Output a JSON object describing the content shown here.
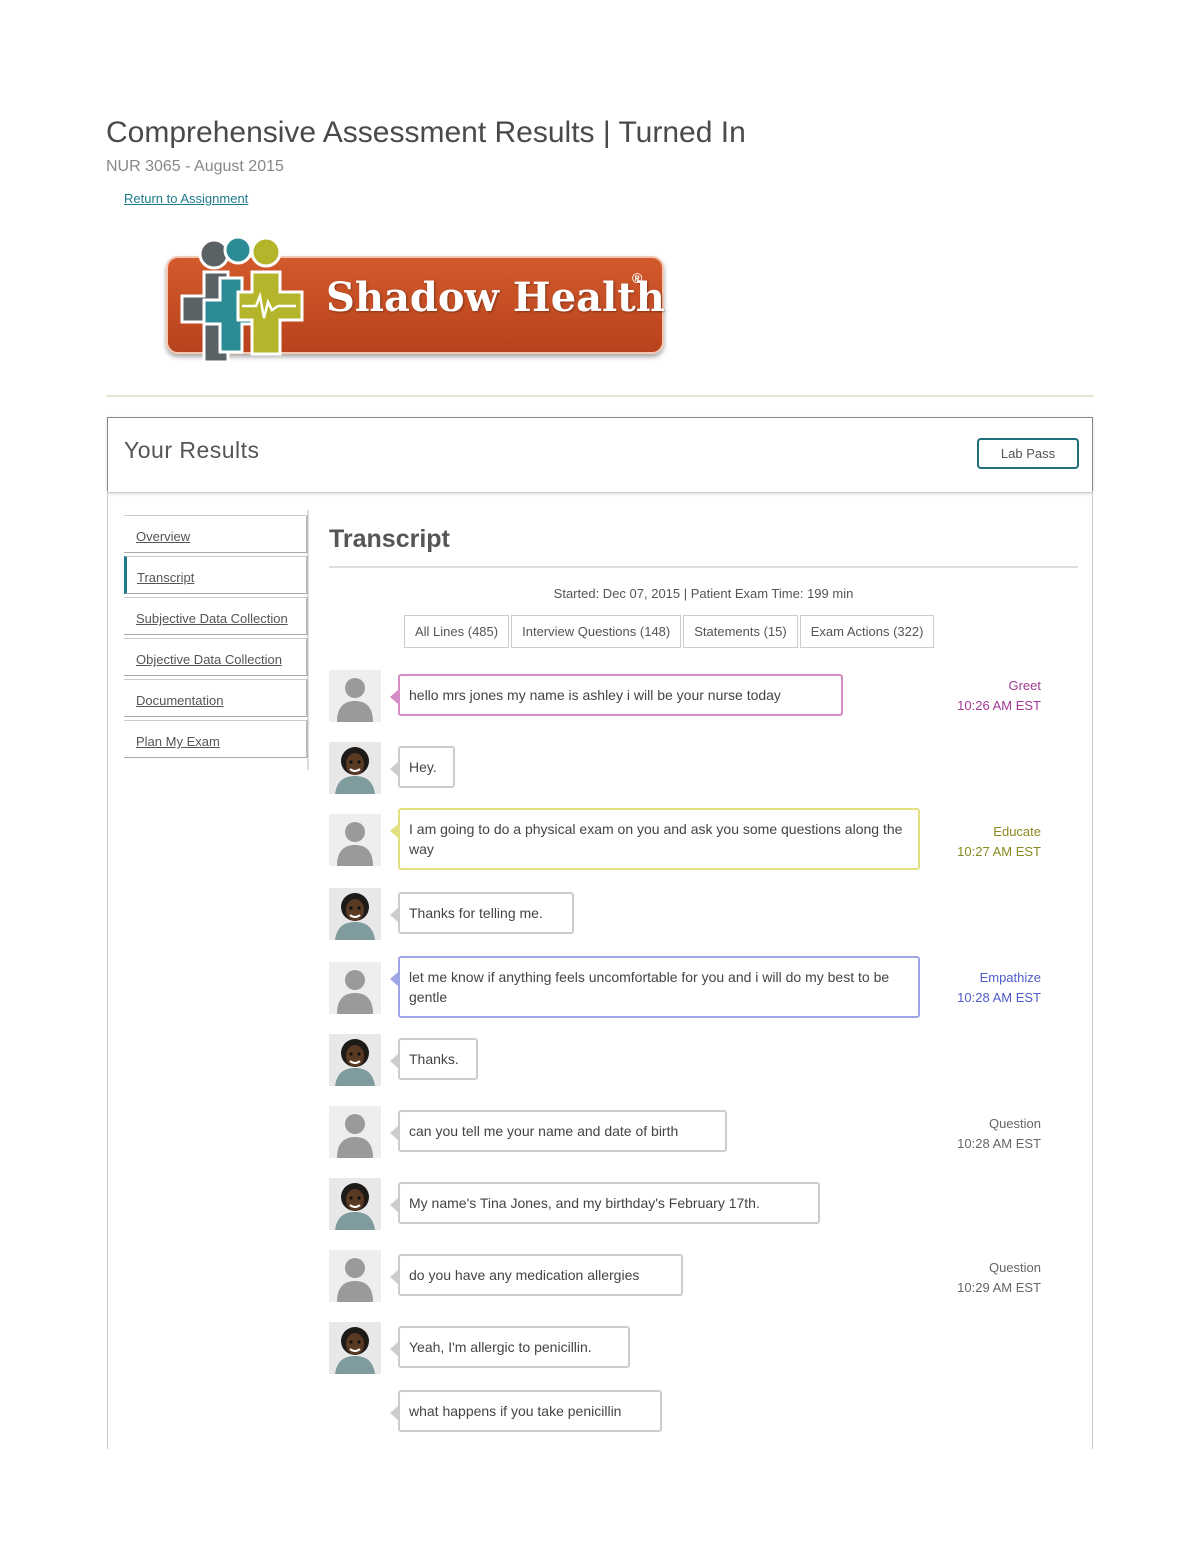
{
  "page": {
    "title": "Comprehensive Assessment Results | Turned In",
    "subtitle": "NUR 3065 - August 2015",
    "return_link": "Return to Assignment"
  },
  "logo": {
    "text": "Shadow Health",
    "registered": "®"
  },
  "results": {
    "title": "Your Results",
    "lab_pass_label": "Lab Pass"
  },
  "sidebar": {
    "items": [
      {
        "label": "Overview",
        "active": false
      },
      {
        "label": "Transcript",
        "active": true
      },
      {
        "label": "Subjective Data Collection",
        "active": false
      },
      {
        "label": "Objective Data Collection",
        "active": false
      },
      {
        "label": "Documentation",
        "active": false
      },
      {
        "label": "Plan My Exam",
        "active": false
      }
    ]
  },
  "transcript": {
    "title": "Transcript",
    "started": "Started: Dec 07, 2015 | Patient Exam Time: 199 min",
    "filters": [
      {
        "label": "All Lines (485)"
      },
      {
        "label": "Interview Questions (148)"
      },
      {
        "label": "Statements (15)"
      },
      {
        "label": "Exam Actions (322)"
      }
    ],
    "messages": [
      {
        "speaker": "student",
        "text": "hello mrs jones my name is ashley i will be your nurse today",
        "category": "Greet",
        "time": "10:26 AM EST"
      },
      {
        "speaker": "patient",
        "text": "Hey."
      },
      {
        "speaker": "student",
        "text": "I am going to do a physical exam on you and ask you some questions along the way",
        "category": "Educate",
        "time": "10:27 AM EST"
      },
      {
        "speaker": "patient",
        "text": "Thanks for telling me."
      },
      {
        "speaker": "student",
        "text": "let me know if anything feels uncomfortable for you and i will do my best to be gentle",
        "category": "Empathize",
        "time": "10:28 AM EST"
      },
      {
        "speaker": "patient",
        "text": "Thanks."
      },
      {
        "speaker": "student",
        "text": "can you tell me your name and date of birth",
        "category": "Question",
        "time": "10:28 AM EST"
      },
      {
        "speaker": "patient",
        "text": "My name's Tina Jones, and my birthday's February 17th."
      },
      {
        "speaker": "student",
        "text": "do you have any medication allergies",
        "category": "Question",
        "time": "10:29 AM EST"
      },
      {
        "speaker": "patient",
        "text": "Yeah, I'm allergic to penicillin."
      },
      {
        "speaker": "student",
        "text": "what happens if you take penicillin"
      }
    ]
  },
  "colors": {
    "accent": "#1f7a8c",
    "logo_banner": "#c94d24",
    "greet": "#a23b93",
    "educate": "#8a8a20",
    "empathize": "#4f5bc9"
  },
  "icons": {
    "student_avatar": "user-silhouette-icon",
    "patient_avatar": "patient-avatar-icon"
  }
}
